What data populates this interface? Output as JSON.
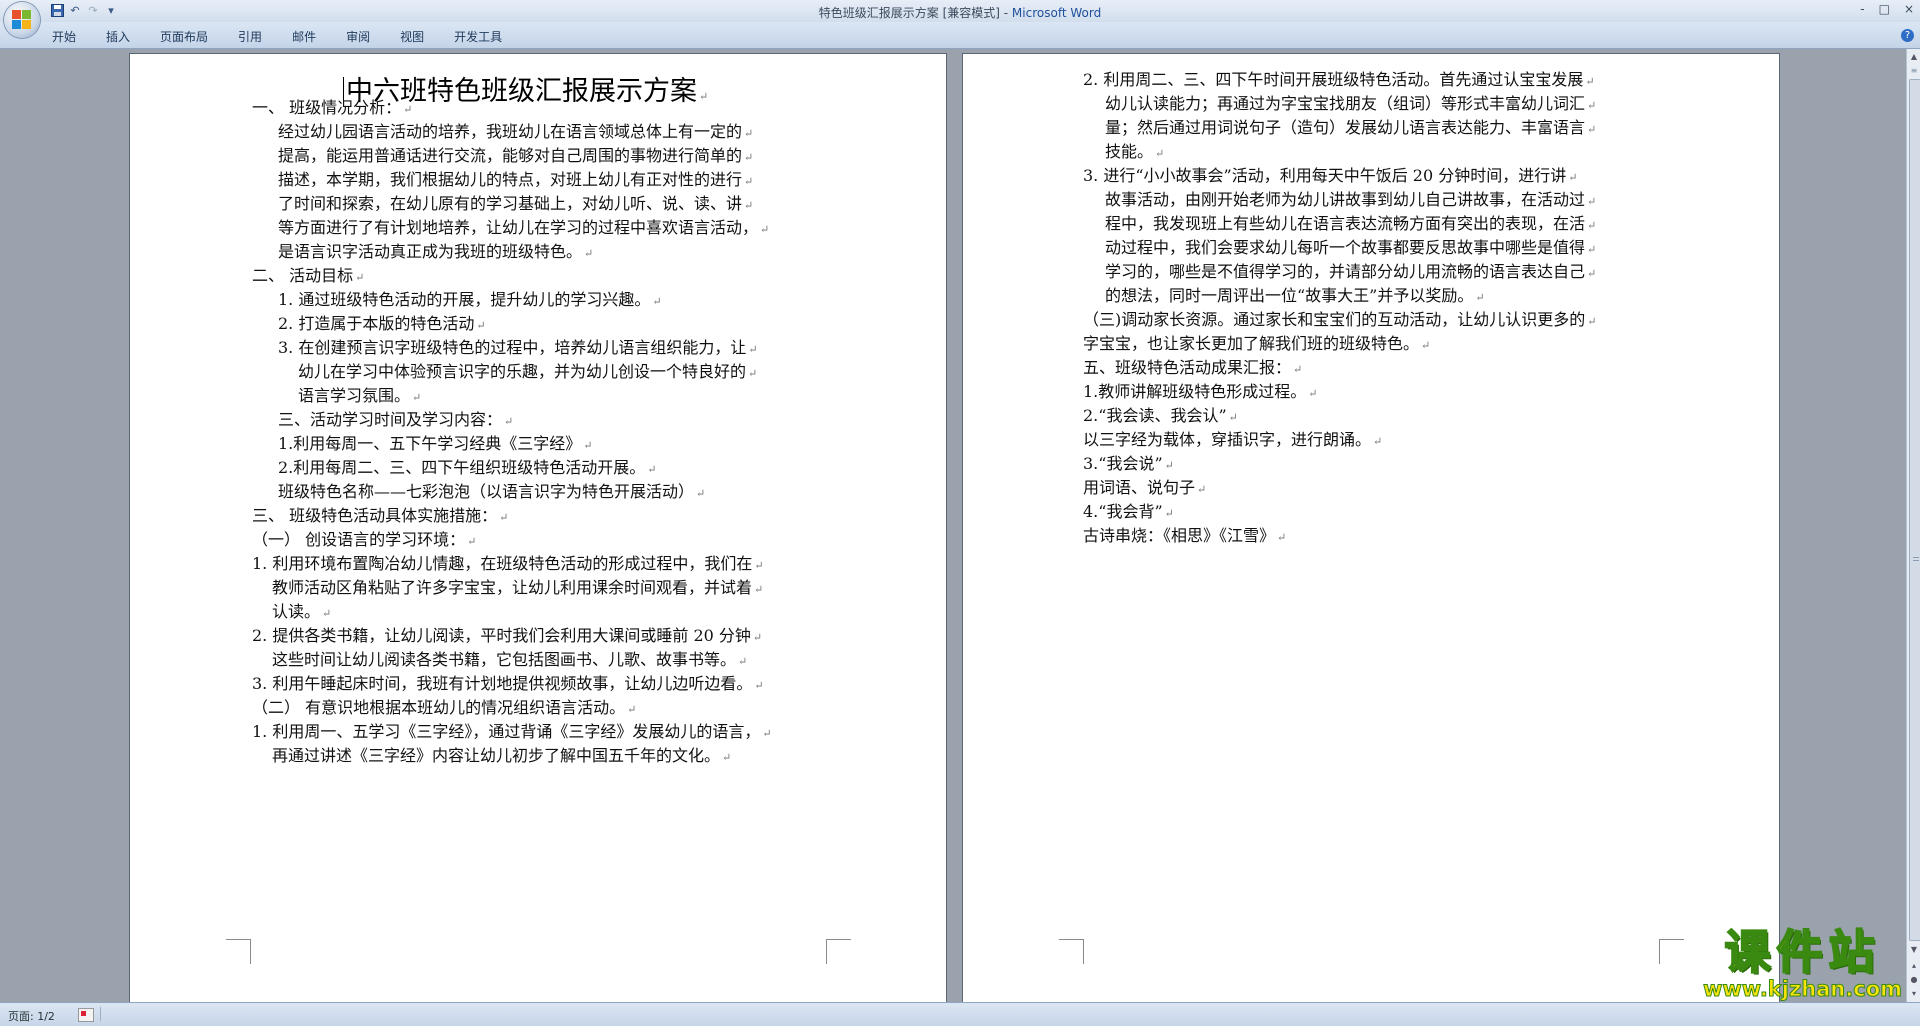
{
  "window": {
    "title": "特色班级汇报展示方案 [兼容模式] - ",
    "app_name": "Microsoft Word",
    "controls": [
      "-",
      "□",
      "×"
    ]
  },
  "qat": {
    "save_icon": "save-icon",
    "undo_glyph": "↶",
    "redo_glyph": "↷",
    "more_glyph": "▾"
  },
  "ribbon": {
    "tabs": [
      "开始",
      "插入",
      "页面布局",
      "引用",
      "邮件",
      "审阅",
      "视图",
      "开发工具"
    ],
    "help": "?"
  },
  "document": {
    "title": "中六班特色班级汇报展示方案",
    "paragraph_mark": "↵",
    "page1_lines": [
      "一、    班级情况分析：",
      "经过幼儿园语言活动的培养，我班幼儿在语言领域总体上有一定的",
      "提高，能运用普通话进行交流，能够对自己周围的事物进行简单的",
      "描述，本学期，我们根据幼儿的特点，对班上幼儿有正对性的进行",
      "了时间和探索，在幼儿原有的学习基础上，对幼儿听、说、读、讲",
      "等方面进行了有计划地培养，让幼儿在学习的过程中喜欢语言活动，",
      "是语言识字活动真正成为我班的班级特色。",
      "二、    活动目标",
      "1.  通过班级特色活动的开展，提升幼儿的学习兴趣。",
      "2.  打造属于本版的特色活动",
      "3.  在创建预言识字班级特色的过程中，培养幼儿语言组织能力，让",
      "幼儿在学习中体验预言识字的乐趣，并为幼儿创设一个特良好的",
      "语言学习氛围。",
      "三、活动学习时间及学习内容：",
      "1.利用每周一、五下午学习经典《三字经》",
      "2.利用每周二、三、四下午组织班级特色活动开展。",
      "班级特色名称——七彩泡泡（以语言识字为特色开展活动）",
      "三、    班级特色活动具体实施措施：",
      "（一）      创设语言的学习环境：",
      "1.  利用环境布置陶冶幼儿情趣，在班级特色活动的形成过程中，我们在",
      "教师活动区角粘贴了许多字宝宝，让幼儿利用课余时间观看，并试着",
      "认读。",
      "2.  提供各类书籍，让幼儿阅读，平时我们会利用大课间或睡前 20 分钟",
      "这些时间让幼儿阅读各类书籍，它包括图画书、儿歌、故事书等。",
      "3.  利用午睡起床时间，我班有计划地提供视频故事，让幼儿边听边看。",
      "（二）      有意识地根据本班幼儿的情况组织语言活动。",
      "1.  利用周一、五学习《三字经》，通过背诵《三字经》发展幼儿的语言，",
      "再通过讲述《三字经》内容让幼儿初步了解中国五千年的文化。"
    ],
    "page2_lines": [
      "2.  利用周二、三、四下午时间开展班级特色活动。首先通过认宝宝发展",
      "幼儿认读能力；再通过为字宝宝找朋友（组词）等形式丰富幼儿词汇",
      "量；然后通过用词说句子（造句）发展幼儿语言表达能力、丰富语言",
      "技能。",
      "3.  进行“小小故事会”活动，利用每天中午饭后 20 分钟时间，进行讲",
      "故事活动，由刚开始老师为幼儿讲故事到幼儿自己讲故事，在活动过",
      "程中，我发现班上有些幼儿在语言表达流畅方面有突出的表现，在活",
      "动过程中，我们会要求幼儿每听一个故事都要反思故事中哪些是值得",
      "学习的，哪些是不值得学习的，并请部分幼儿用流畅的语言表达自己",
      "的想法，同时一周评出一位“故事大王”并予以奖励。",
      "（三)调动家长资源。通过家长和宝宝们的互动活动，让幼儿认识更多的",
      "字宝宝，也让家长更加了解我们班的班级特色。",
      "五、班级特色活动成果汇报：",
      "1.教师讲解班级特色形成过程。",
      "2.“我会读、我会认”",
      "以三字经为载体，穿插识字，进行朗诵。",
      "3.“我会说”",
      "用词语、说句子",
      "4.“我会背”",
      "古诗串烧：《相思》《江雪》"
    ]
  },
  "statusbar": {
    "page_info": "页面: 1/2"
  },
  "scrollbar": {
    "up": "▲",
    "down": "▼",
    "prev": "▴",
    "next": "▾",
    "browse": "●"
  },
  "watermark": {
    "main": "课件站",
    "sub": "www.kjzhan.com"
  }
}
